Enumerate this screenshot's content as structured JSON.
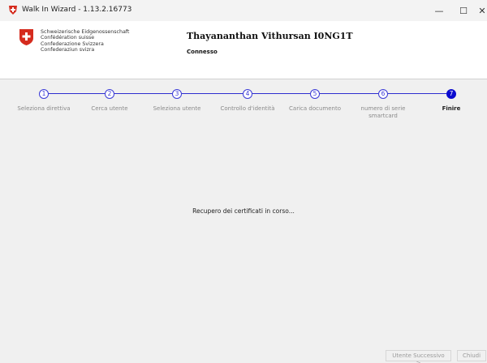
{
  "window": {
    "title": "Walk In Wizard - 1.13.2.16773",
    "minimize_glyph": "—",
    "maximize_glyph": "☐",
    "close_glyph": "✕",
    "app_icon": "swiss-app-icon"
  },
  "header": {
    "confederation_lines": [
      "Schweizerische Eidgenossenschaft",
      "Confédération suisse",
      "Confederazione Svizzera",
      "Confederaziun svizra"
    ],
    "user_name": "Thayananthan Vithursan I0NG1T",
    "status": "Connesso",
    "logo": "swiss-cross-logo"
  },
  "steps": [
    {
      "number": "1",
      "label": "Seleziona direttiva",
      "active": false
    },
    {
      "number": "2",
      "label": "Cerca utente",
      "active": false
    },
    {
      "number": "3",
      "label": "Seleziona utente",
      "active": false
    },
    {
      "number": "4",
      "label": "Controllo d'identità",
      "active": false
    },
    {
      "number": "5",
      "label": "Carica documento",
      "active": false
    },
    {
      "number": "6",
      "label": "numero di serie smartcard",
      "active": false
    },
    {
      "number": "7",
      "label": "Finire",
      "active": true
    }
  ],
  "main": {
    "message": "Recupero dei certificati in corso..."
  },
  "footer": {
    "next_label": "Utente Successivo >",
    "close_label": "Chiudi"
  },
  "colors": {
    "step_accent": "#3a3ad6",
    "step_active_fill": "#0b0bcf",
    "swiss_red": "#d52b1e"
  }
}
